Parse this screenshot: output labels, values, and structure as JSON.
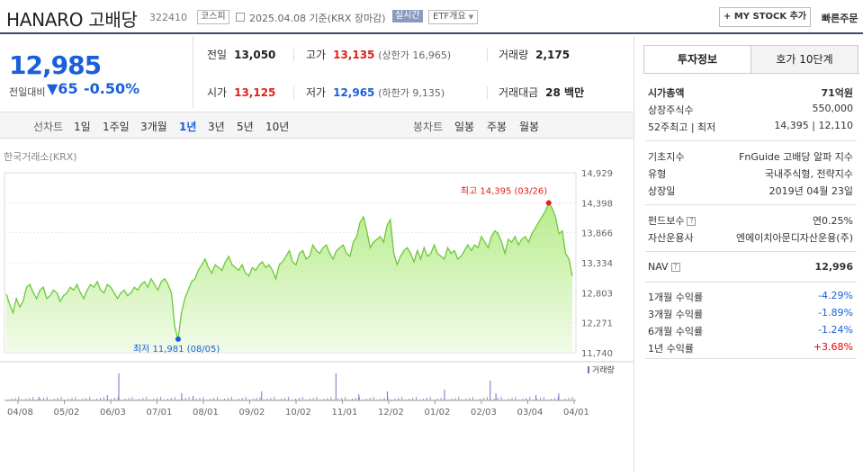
{
  "header": {
    "name": "HANARO 고배당",
    "code": "322410",
    "market": "코스피",
    "date_text": "2025.04.08 기준(KRX 장마감)",
    "realtime": "실시간",
    "etf_info": "ETF개요",
    "my_stock": "+ MY STOCK 추가",
    "quick_order": "빠른주문"
  },
  "quote": {
    "price": "12,985",
    "change_label": "전일대비",
    "change": "▼65",
    "percent": "-0.50%",
    "prev_close_label": "전일",
    "prev_close": "13,050",
    "high_label": "고가",
    "high": "13,135",
    "upper_limit": "(상한가 16,965)",
    "volume_label": "거래량",
    "volume": "2,175",
    "open_label": "시가",
    "open": "13,125",
    "low_label": "저가",
    "low": "12,965",
    "lower_limit": "(하한가 9,135)",
    "amount_label": "거래대금",
    "amount": "28 백만"
  },
  "periods": {
    "line_label": "선차트",
    "items": [
      "1일",
      "1주일",
      "3개월",
      "1년",
      "3년",
      "5년",
      "10년"
    ],
    "active": "1년",
    "candle_label": "봉차트",
    "candles": [
      "일봉",
      "주봉",
      "월봉"
    ]
  },
  "chart_data": {
    "type": "area",
    "source": "한국거래소(KRX)",
    "x_ticks": [
      "04/08",
      "05/02",
      "06/03",
      "07/01",
      "08/01",
      "09/02",
      "10/02",
      "11/01",
      "12/02",
      "01/02",
      "02/03",
      "03/04",
      "04/01"
    ],
    "y_ticks": [
      "14,929",
      "14,398",
      "13,866",
      "13,334",
      "12,803",
      "12,271",
      "11,740"
    ],
    "ylim": [
      11740,
      14929
    ],
    "high_label": "최고 14,395 (03/26)",
    "low_label": "최저 11,981 (08/05)",
    "volume_label": "거래량",
    "values": [
      12780,
      12600,
      12450,
      12700,
      12550,
      12650,
      12900,
      12950,
      12800,
      12700,
      12850,
      12900,
      12700,
      12750,
      12850,
      12800,
      12650,
      12750,
      12800,
      12900,
      12850,
      12950,
      12800,
      12700,
      12850,
      12950,
      12900,
      13000,
      12850,
      12800,
      12950,
      12900,
      12800,
      12700,
      12800,
      12850,
      12750,
      12800,
      12900,
      12850,
      12950,
      13000,
      12900,
      13050,
      12950,
      12850,
      13000,
      13050,
      12950,
      12800,
      12200,
      11981,
      12450,
      12700,
      12850,
      13000,
      13050,
      13200,
      13300,
      13400,
      13250,
      13150,
      13300,
      13250,
      13200,
      13350,
      13450,
      13300,
      13250,
      13200,
      13300,
      13150,
      13100,
      13250,
      13200,
      13300,
      13350,
      13250,
      13300,
      13200,
      13050,
      13300,
      13350,
      13450,
      13550,
      13350,
      13300,
      13500,
      13550,
      13400,
      13450,
      13650,
      13550,
      13500,
      13600,
      13650,
      13500,
      13400,
      13550,
      13600,
      13650,
      13500,
      13450,
      13700,
      13800,
      14050,
      14150,
      13900,
      13600,
      13700,
      13750,
      13800,
      13700,
      14000,
      14100,
      13500,
      13300,
      13450,
      13550,
      13600,
      13500,
      13350,
      13550,
      13400,
      13600,
      13450,
      13500,
      13650,
      13500,
      13450,
      13400,
      13600,
      13500,
      13550,
      13400,
      13450,
      13550,
      13650,
      13550,
      13650,
      13600,
      13800,
      13700,
      13600,
      13800,
      13900,
      13850,
      13700,
      13500,
      13750,
      13700,
      13800,
      13650,
      13750,
      13800,
      13700,
      13850,
      13950,
      14050,
      14150,
      14250,
      14395,
      14300,
      14150,
      13850,
      13900,
      13500,
      13400,
      13100
    ]
  },
  "right_panel": {
    "tab_invest": "투자정보",
    "tab_order": "호가 10단계",
    "market_cap_label": "시가총액",
    "market_cap": "71억원",
    "shares_label": "상장주식수",
    "shares": "550,000",
    "w52_label": "52주최고 | 최저",
    "w52": "14,395 | 12,110",
    "index_label": "기초지수",
    "index": "FnGuide 고배당 알파 지수",
    "type_label": "유형",
    "type": "국내주식형, 전략지수",
    "listed_label": "상장일",
    "listed": "2019년 04월 23일",
    "fee_label": "펀드보수",
    "fee": "연0.25%",
    "manager_label": "자산운용사",
    "manager": "엔에이치아문디자산운용(주)",
    "nav_label": "NAV",
    "nav": "12,996",
    "r1m_label": "1개월 수익률",
    "r1m": "-4.29%",
    "r3m_label": "3개월 수익률",
    "r3m": "-1.89%",
    "r6m_label": "6개월 수익률",
    "r6m": "-1.24%",
    "r1y_label": "1년 수익률",
    "r1y": "+3.68%"
  }
}
